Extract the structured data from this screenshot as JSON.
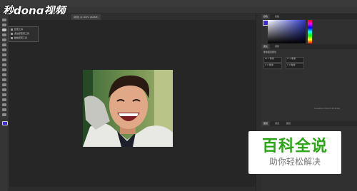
{
  "watermark": {
    "logo_text": "秒dong视频"
  },
  "document": {
    "tab_title": "(新建) @ 100% (RGB/8)"
  },
  "tool_flyout": {
    "items": [
      "套索工具",
      "多边形套索工具",
      "磁性套索工具"
    ]
  },
  "panels": {
    "color_tabs": [
      "颜色",
      "色板"
    ],
    "properties_tabs": [
      "属性",
      "调整"
    ],
    "properties_title": "像素图层属性",
    "field_w": "W 1 像素",
    "field_h": "H 1 像素",
    "field_x": "X 0 像素",
    "field_y": "Y 0 像素",
    "layers_tabs": [
      "图层",
      "通道",
      "路径"
    ],
    "cc_libraries": "Creative Cloud Libraries"
  },
  "badge": {
    "title": "百科全说",
    "subtitle": "助你轻松解决"
  },
  "colors": {
    "foreground": "#3a2bd0",
    "badge_green": "#2aa515",
    "ui_dark": "#282828"
  }
}
